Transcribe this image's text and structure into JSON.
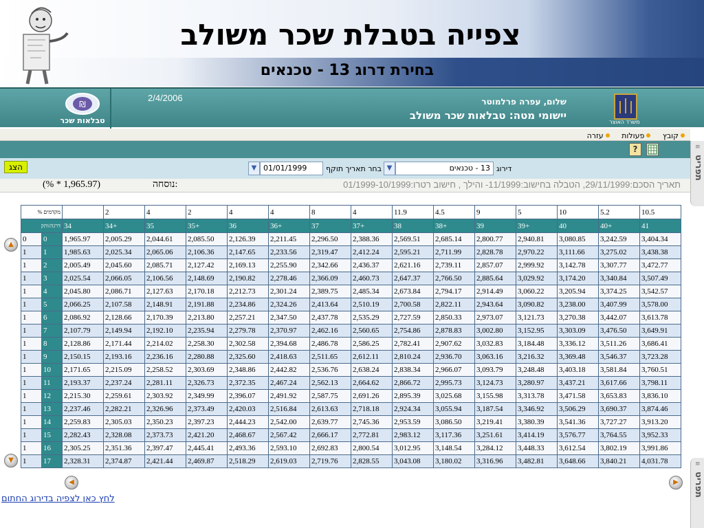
{
  "slide": {
    "title": "צפייה בטבלת שכר משולב",
    "subtitle": "בחירת דרוג 13 - טכנאים"
  },
  "header": {
    "date": "2/4/2006",
    "greeting": "שלום,  עפרה פרלמוטר",
    "app_title": "יישומי מטה:  טבלאות שכר משולב",
    "left_logo_text": "טבלאות שכר",
    "right_logo_text": "משרד האוצר"
  },
  "menu": [
    "קובץ",
    "פעולות",
    "עזרה"
  ],
  "filters": {
    "show_button": "הצג",
    "grade_label": "דירוג",
    "grade_value": "13 - טכנאים",
    "date_label": "בחר תאריך תוקף",
    "date_value": "01/01/1999"
  },
  "info": {
    "text": "תאריך הסכם:29/11/1999, הטבלה בחישוב:11/1999- והילך , חישוב רטרו:01/1999-10/1999",
    "formula_label": "נוסחה:",
    "formula_value": "(% * 1,965.97)"
  },
  "side_tab": "תפריט",
  "footer_link": "לחץ כאן לצפיה בדירוג החתום",
  "table": {
    "corner_top": "% מקדמים",
    "corner_bottom": "דרגה/ותק",
    "pct": [
      "",
      "2",
      "4",
      "2",
      "4",
      "4",
      "8",
      "4",
      "11.9",
      "4.5",
      "9",
      "5",
      "10",
      "5.2",
      "10.5"
    ],
    "grades": [
      "34",
      "34+",
      "35",
      "35+",
      "36",
      "36+",
      "37",
      "37+",
      "38",
      "38+",
      "39",
      "39+",
      "40",
      "40+",
      "41"
    ],
    "rows": [
      {
        "a": "0",
        "b": "0",
        "v": [
          "1,965.97",
          "2,005.29",
          "2,044.61",
          "2,085.50",
          "2,126.39",
          "2,211.45",
          "2,296.50",
          "2,388.36",
          "2,569.51",
          "2,685.14",
          "2,800.77",
          "2,940.81",
          "3,080.85",
          "3,242.59",
          "3,404.34"
        ]
      },
      {
        "a": "1",
        "b": "1",
        "v": [
          "1,985.63",
          "2,025.34",
          "2,065.06",
          "2,106.36",
          "2,147.65",
          "2,233.56",
          "2,319.47",
          "2,412.24",
          "2,595.21",
          "2,711.99",
          "2,828.78",
          "2,970.22",
          "3,111.66",
          "3,275.02",
          "3,438.38"
        ]
      },
      {
        "a": "1",
        "b": "2",
        "v": [
          "2,005.49",
          "2,045.60",
          "2,085.71",
          "2,127.42",
          "2,169.13",
          "2,255.90",
          "2,342.66",
          "2,436.37",
          "2,621.16",
          "2,739.11",
          "2,857.07",
          "2,999.92",
          "3,142.78",
          "3,307.77",
          "3,472.77"
        ]
      },
      {
        "a": "1",
        "b": "3",
        "v": [
          "2,025.54",
          "2,066.05",
          "2,106.56",
          "2,148.69",
          "2,190.82",
          "2,278.46",
          "2,366.09",
          "2,460.73",
          "2,647.37",
          "2,766.50",
          "2,885.64",
          "3,029.92",
          "3,174.20",
          "3,340.84",
          "3,507.49"
        ]
      },
      {
        "a": "1",
        "b": "4",
        "v": [
          "2,045.80",
          "2,086.71",
          "2,127.63",
          "2,170.18",
          "2,212.73",
          "2,301.24",
          "2,389.75",
          "2,485.34",
          "2,673.84",
          "2,794.17",
          "2,914.49",
          "3,060.22",
          "3,205.94",
          "3,374.25",
          "3,542.57"
        ]
      },
      {
        "a": "1",
        "b": "5",
        "v": [
          "2,066.25",
          "2,107.58",
          "2,148.91",
          "2,191.88",
          "2,234.86",
          "2,324.26",
          "2,413.64",
          "2,510.19",
          "2,700.58",
          "2,822.11",
          "2,943.64",
          "3,090.82",
          "3,238.00",
          "3,407.99",
          "3,578.00"
        ]
      },
      {
        "a": "1",
        "b": "6",
        "v": [
          "2,086.92",
          "2,128.66",
          "2,170.39",
          "2,213.80",
          "2,257.21",
          "2,347.50",
          "2,437.78",
          "2,535.29",
          "2,727.59",
          "2,850.33",
          "2,973.07",
          "3,121.73",
          "3,270.38",
          "3,442.07",
          "3,613.78"
        ]
      },
      {
        "a": "1",
        "b": "7",
        "v": [
          "2,107.79",
          "2,149.94",
          "2,192.10",
          "2,235.94",
          "2,279.78",
          "2,370.97",
          "2,462.16",
          "2,560.65",
          "2,754.86",
          "2,878.83",
          "3,002.80",
          "3,152.95",
          "3,303.09",
          "3,476.50",
          "3,649.91"
        ]
      },
      {
        "a": "1",
        "b": "8",
        "v": [
          "2,128.86",
          "2,171.44",
          "2,214.02",
          "2,258.30",
          "2,302.58",
          "2,394.68",
          "2,486.78",
          "2,586.25",
          "2,782.41",
          "2,907.62",
          "3,032.83",
          "3,184.48",
          "3,336.12",
          "3,511.26",
          "3,686.41"
        ]
      },
      {
        "a": "1",
        "b": "9",
        "v": [
          "2,150.15",
          "2,193.16",
          "2,236.16",
          "2,280.88",
          "2,325.60",
          "2,418.63",
          "2,511.65",
          "2,612.11",
          "2,810.24",
          "2,936.70",
          "3,063.16",
          "3,216.32",
          "3,369.48",
          "3,546.37",
          "3,723.28"
        ]
      },
      {
        "a": "1",
        "b": "10",
        "v": [
          "2,171.65",
          "2,215.09",
          "2,258.52",
          "2,303.69",
          "2,348.86",
          "2,442.82",
          "2,536.76",
          "2,638.24",
          "2,838.34",
          "2,966.07",
          "3,093.79",
          "3,248.48",
          "3,403.18",
          "3,581.84",
          "3,760.51"
        ]
      },
      {
        "a": "1",
        "b": "11",
        "v": [
          "2,193.37",
          "2,237.24",
          "2,281.11",
          "2,326.73",
          "2,372.35",
          "2,467.24",
          "2,562.13",
          "2,664.62",
          "2,866.72",
          "2,995.73",
          "3,124.73",
          "3,280.97",
          "3,437.21",
          "3,617.66",
          "3,798.11"
        ]
      },
      {
        "a": "1",
        "b": "12",
        "v": [
          "2,215.30",
          "2,259.61",
          "2,303.92",
          "2,349.99",
          "2,396.07",
          "2,491.92",
          "2,587.75",
          "2,691.26",
          "2,895.39",
          "3,025.68",
          "3,155.98",
          "3,313.78",
          "3,471.58",
          "3,653.83",
          "3,836.10"
        ]
      },
      {
        "a": "1",
        "b": "13",
        "v": [
          "2,237.46",
          "2,282.21",
          "2,326.96",
          "2,373.49",
          "2,420.03",
          "2,516.84",
          "2,613.63",
          "2,718.18",
          "2,924.34",
          "3,055.94",
          "3,187.54",
          "3,346.92",
          "3,506.29",
          "3,690.37",
          "3,874.46"
        ]
      },
      {
        "a": "1",
        "b": "14",
        "v": [
          "2,259.83",
          "2,305.03",
          "2,350.23",
          "2,397.23",
          "2,444.23",
          "2,542.00",
          "2,639.77",
          "2,745.36",
          "2,953.59",
          "3,086.50",
          "3,219.41",
          "3,380.39",
          "3,541.36",
          "3,727.27",
          "3,913.20"
        ]
      },
      {
        "a": "1",
        "b": "15",
        "v": [
          "2,282.43",
          "2,328.08",
          "2,373.73",
          "2,421.20",
          "2,468.67",
          "2,567.42",
          "2,666.17",
          "2,772.81",
          "2,983.12",
          "3,117.36",
          "3,251.61",
          "3,414.19",
          "3,576.77",
          "3,764.55",
          "3,952.33"
        ]
      },
      {
        "a": "1",
        "b": "16",
        "v": [
          "2,305.25",
          "2,351.36",
          "2,397.47",
          "2,445.41",
          "2,493.36",
          "2,593.10",
          "2,692.83",
          "2,800.54",
          "3,012.95",
          "3,148.54",
          "3,284.12",
          "3,448.33",
          "3,612.54",
          "3,802.19",
          "3,991.86"
        ]
      },
      {
        "a": "1",
        "b": "17",
        "v": [
          "2,328.31",
          "2,374.87",
          "2,421.44",
          "2,469.87",
          "2,518.29",
          "2,619.03",
          "2,719.76",
          "2,828.55",
          "3,043.08",
          "3,180.02",
          "3,316.96",
          "3,482.81",
          "3,648.66",
          "3,840.21",
          "4,031.78"
        ]
      }
    ]
  }
}
